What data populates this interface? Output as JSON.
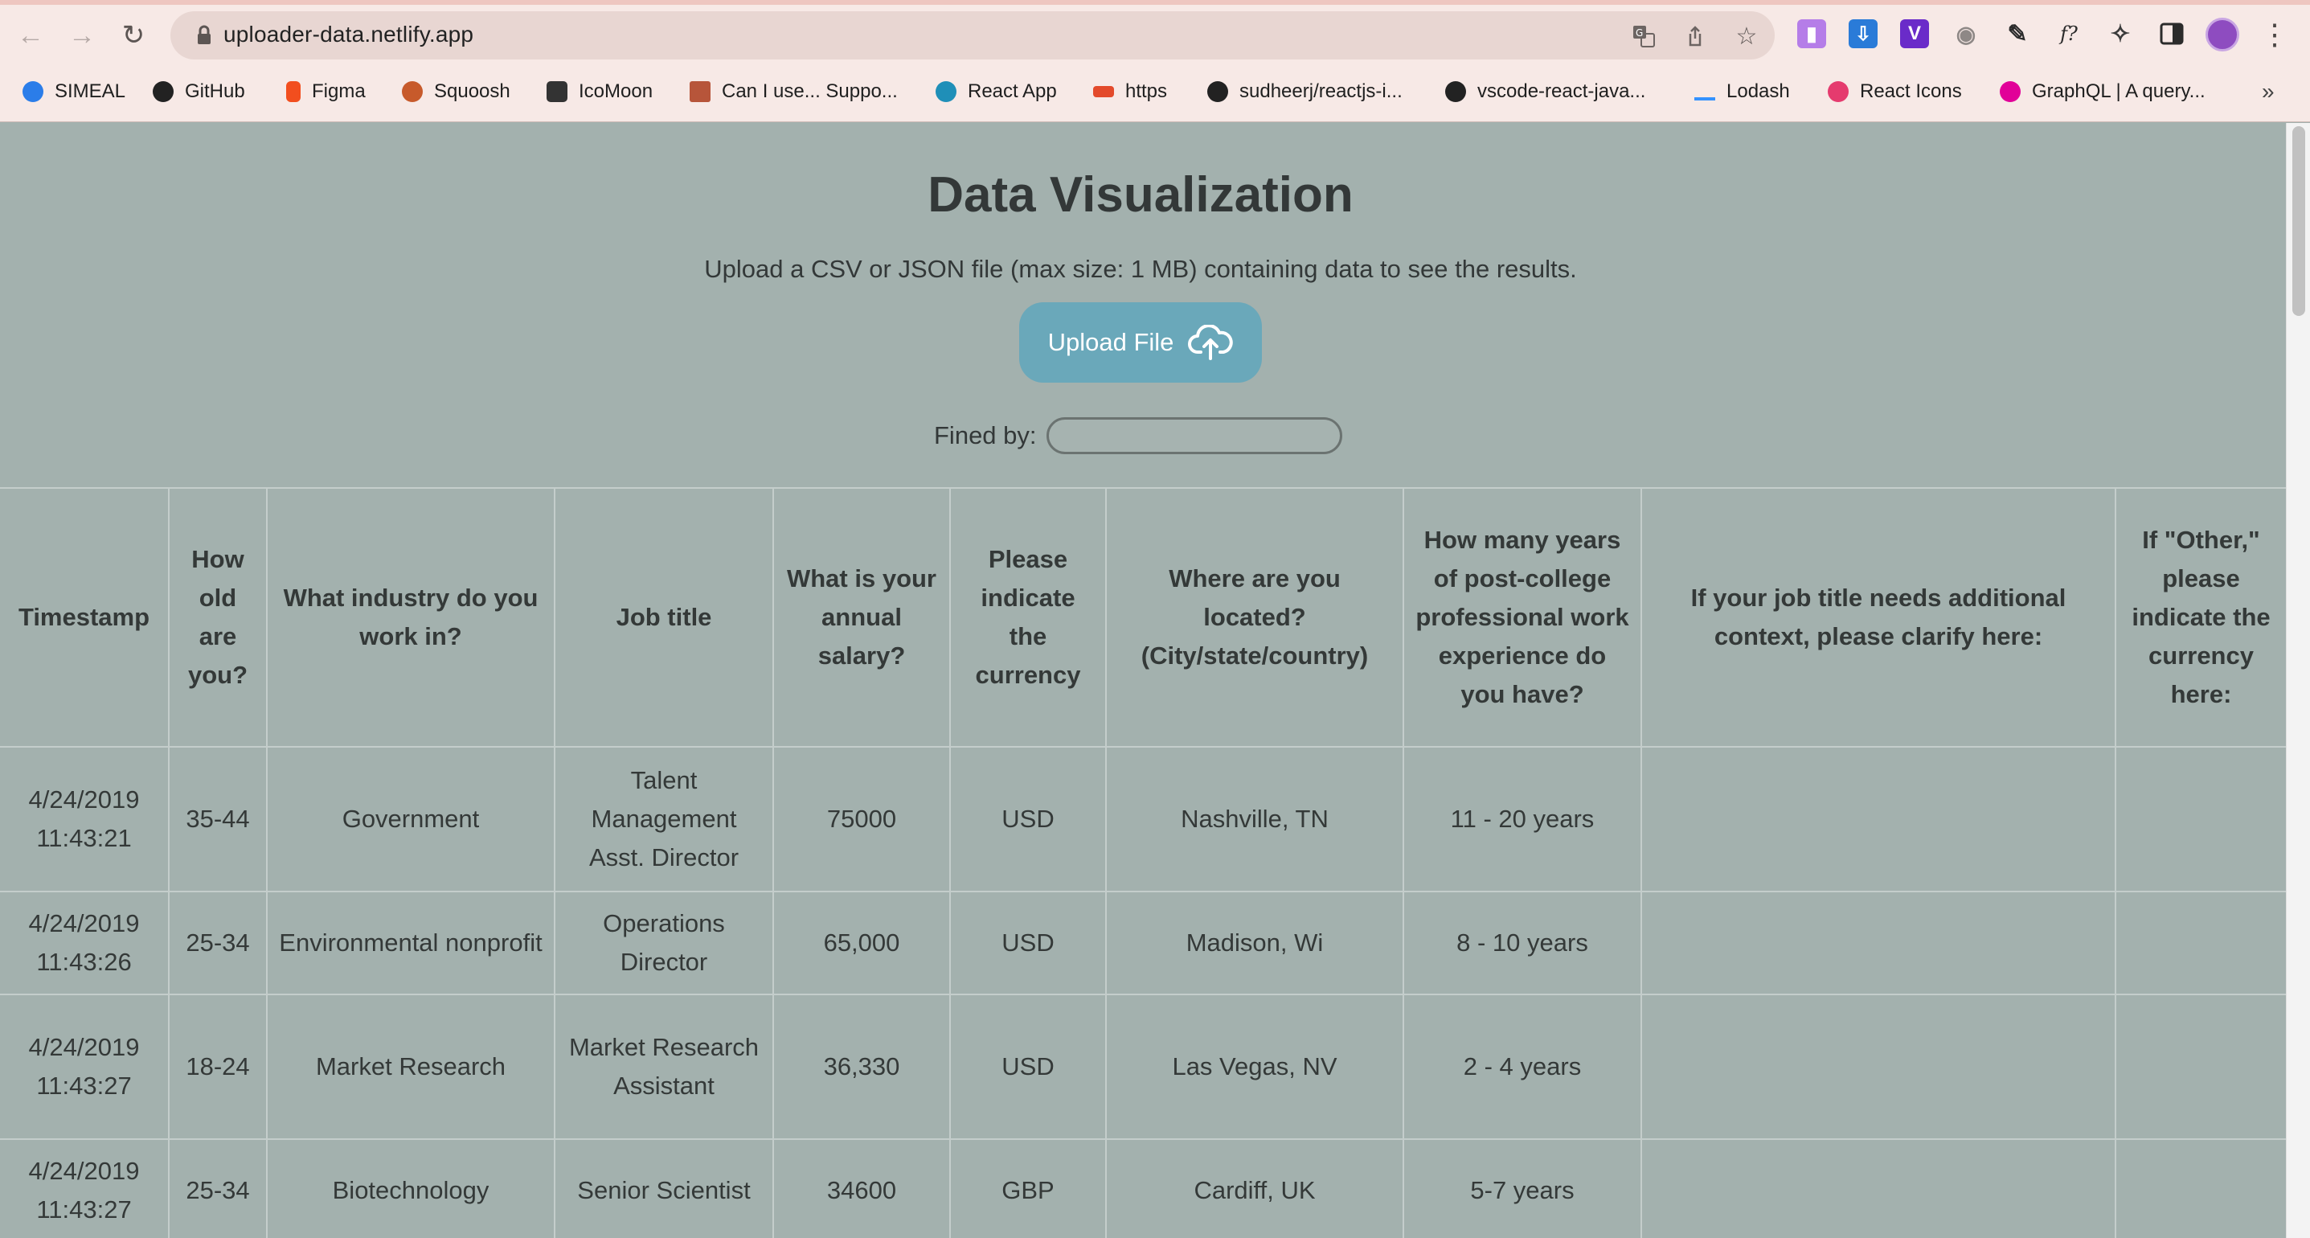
{
  "browser": {
    "url": "uploader-data.netlify.app",
    "bookmarks": [
      {
        "label": "SIMEAL",
        "icon": "simeal-icon",
        "color": "#2b7de9"
      },
      {
        "label": "GitHub",
        "icon": "github-icon",
        "color": "#222222"
      },
      {
        "label": "Figma",
        "icon": "figma-icon",
        "color": "#f24e1e"
      },
      {
        "label": "Squoosh",
        "icon": "squoosh-icon",
        "color": "#c75a2b"
      },
      {
        "label": "IcoMoon",
        "icon": "icomoon-icon",
        "color": "#333333"
      },
      {
        "label": "Can I use... Suppo...",
        "icon": "caniuse-icon",
        "color": "#b7553a"
      },
      {
        "label": "React App",
        "icon": "react-icon",
        "color": "#1f8fb8"
      },
      {
        "label": "https",
        "icon": "https-icon",
        "color": "#e34a2b"
      },
      {
        "label": "sudheerj/reactjs-i...",
        "icon": "github-icon",
        "color": "#222222"
      },
      {
        "label": "vscode-react-java...",
        "icon": "github-icon",
        "color": "#222222"
      },
      {
        "label": "Lodash",
        "icon": "lodash-icon",
        "color": "#3492ff"
      },
      {
        "label": "React Icons",
        "icon": "react-icons-icon",
        "color": "#e53b6e"
      },
      {
        "label": "GraphQL | A query...",
        "icon": "graphql-icon",
        "color": "#e10098"
      }
    ],
    "overflow": "»"
  },
  "page": {
    "title": "Data Visualization",
    "subtitle": "Upload a CSV or JSON file (max size: 1 MB) containing data to see the results.",
    "upload_label": "Upload File",
    "filter_label": "Fined by:",
    "filter_value": "",
    "accent": "#6aa8ba"
  },
  "table": {
    "headers": [
      "Timestamp",
      "How old are you?",
      "What industry do you work in?",
      "Job title",
      "What is your annual salary?",
      "Please indicate the currency",
      "Where are you located? (City/state/country)",
      "How many years of post-college professional work experience do you have?",
      "If your job title needs additional context, please clarify here:",
      "If \"Other,\" please indicate the currency here:"
    ],
    "rows": [
      [
        "4/24/2019 11:43:21",
        "35-44",
        "Government",
        "Talent Management Asst. Director",
        "75000",
        "USD",
        "Nashville, TN",
        "11 - 20 years",
        "",
        ""
      ],
      [
        "4/24/2019 11:43:26",
        "25-34",
        "Environmental nonprofit",
        "Operations Director",
        "65,000",
        "USD",
        "Madison, Wi",
        "8 - 10 years",
        "",
        ""
      ],
      [
        "4/24/2019 11:43:27",
        "18-24",
        "Market Research",
        "Market Research Assistant",
        "36,330",
        "USD",
        "Las Vegas, NV",
        "2 - 4 years",
        "",
        ""
      ],
      [
        "4/24/2019 11:43:27",
        "25-34",
        "Biotechnology",
        "Senior Scientist",
        "34600",
        "GBP",
        "Cardiff, UK",
        "5-7 years",
        "",
        ""
      ]
    ]
  }
}
